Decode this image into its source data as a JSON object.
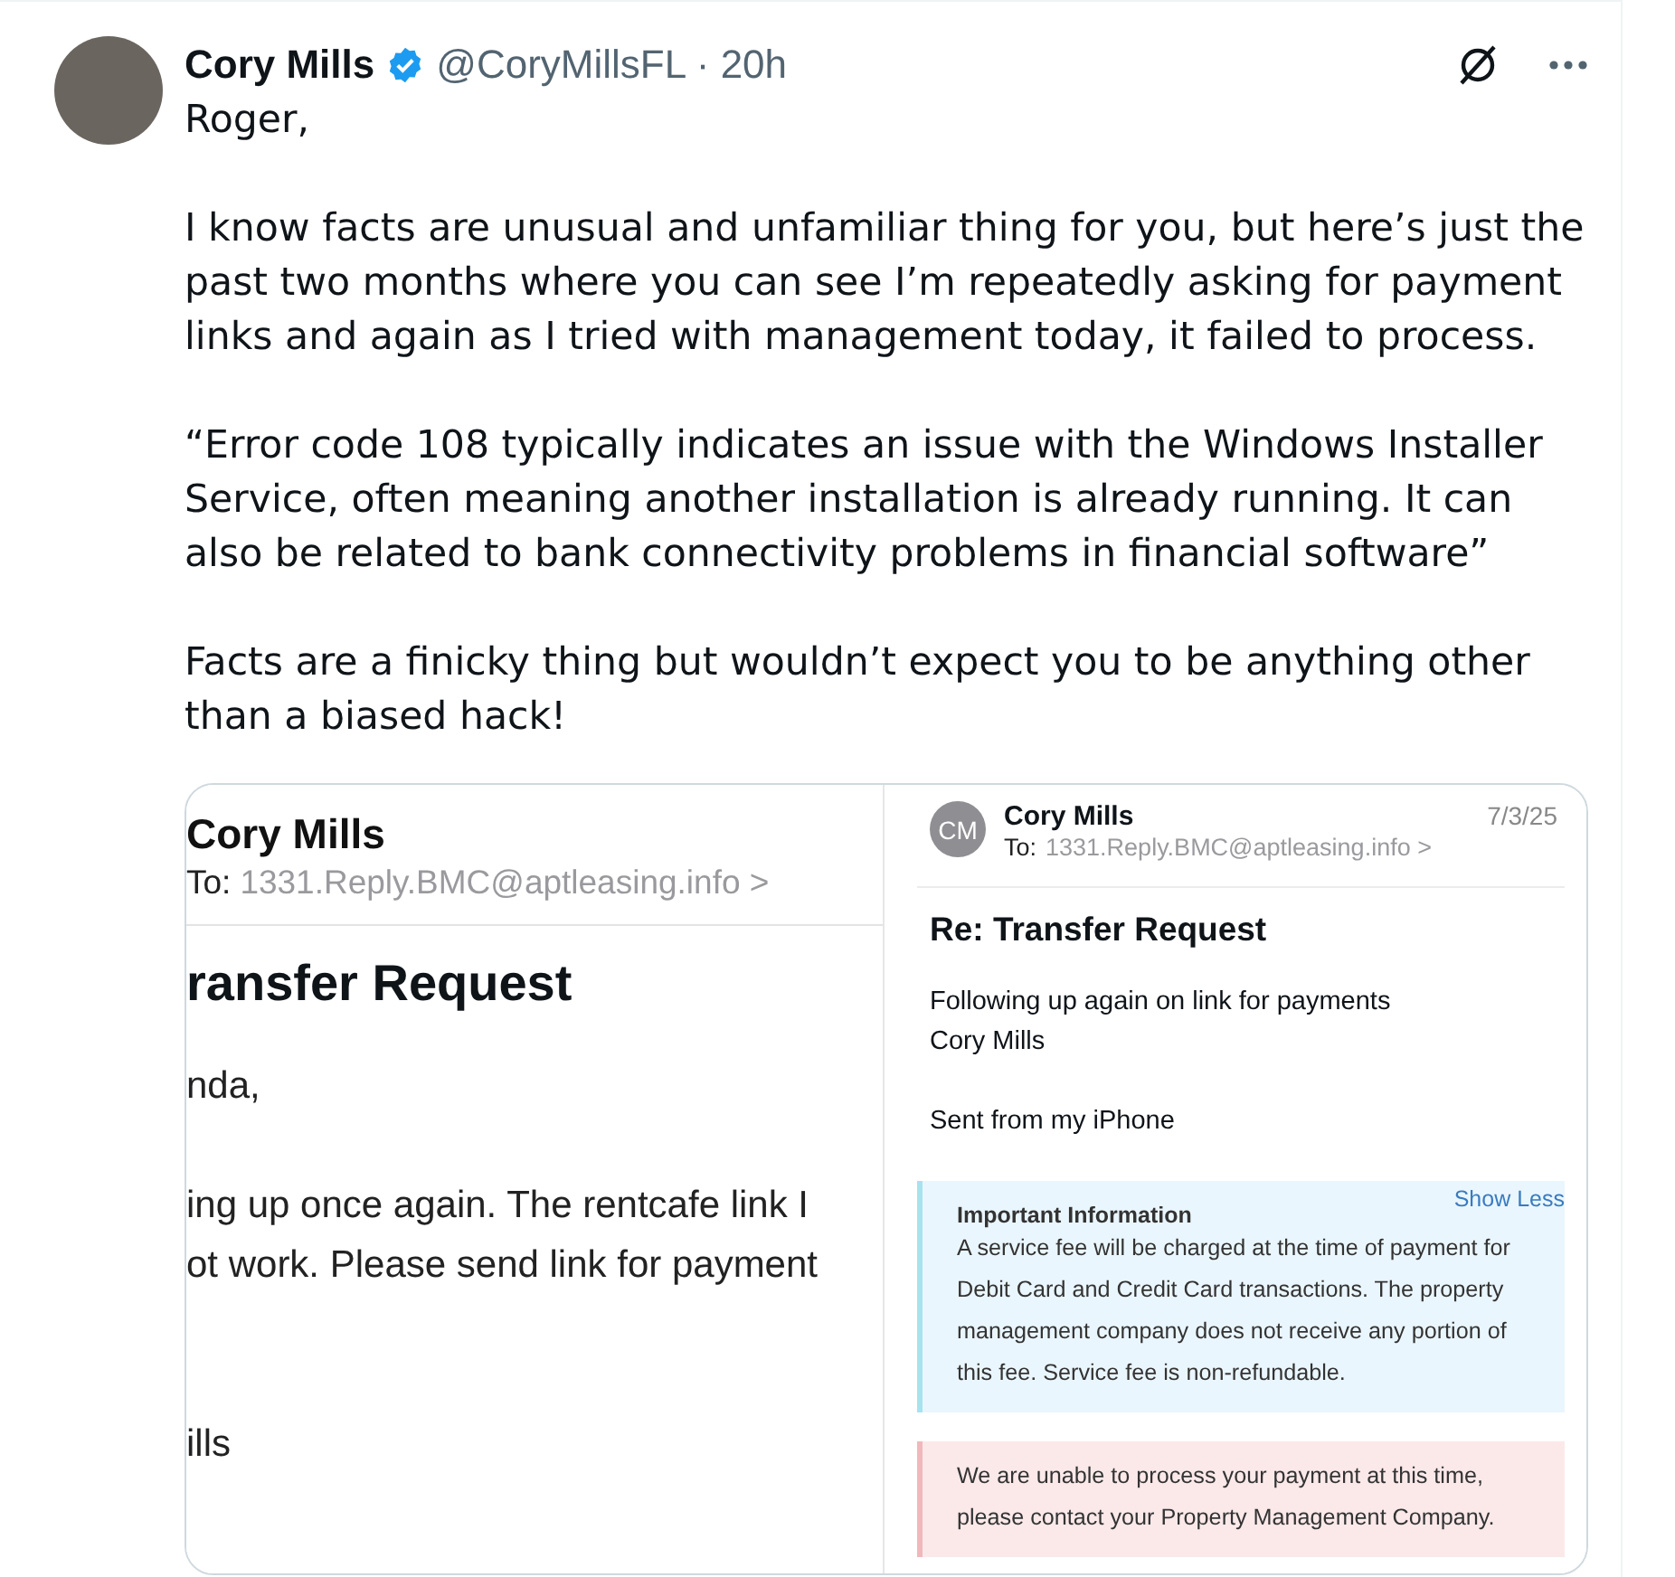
{
  "post": {
    "author": {
      "name": "Cory Mills",
      "verified": true,
      "meta": "@CoryMillsFL · 20h"
    },
    "paragraphs": [
      "Roger,",
      "I know facts are unusual and unfamiliar thing for you, but here’s just the past two months where you can see I’m repeatedly asking for payment links and again as I tried with management today, it failed to process.",
      "“Error code 108 typically indicates an issue with the Windows Installer Service, often meaning another installation is already running. It can also be related to bank connectivity problems in financial software”",
      "Facts are a finicky thing but wouldn’t expect you to be anything other than a biased hack!"
    ]
  },
  "media": {
    "left": {
      "sender": "Cory Mills",
      "to_label": "To:",
      "to_address": "1331.Reply.BMC@aptleasing.info >",
      "subject": "ransfer Request",
      "greeting": "nda,",
      "body_lines": [
        "ing up once again. The rentcafe link I",
        "ot work. Please send link for payment"
      ],
      "signature": "ills"
    },
    "right": {
      "initials": "CM",
      "sender": "Cory Mills",
      "to_label": "To:",
      "to_address": "1331.Reply.BMC@aptleasing.info >",
      "date": "7/3/25",
      "subject": "Re: Transfer Request",
      "body_lines": [
        "Following up again on link for payments",
        "Cory Mills"
      ],
      "footer": "Sent from my iPhone",
      "notices": [
        {
          "kind": "info",
          "title": "Important Information",
          "action": "Show Less",
          "text": "A service fee will be charged at the time of payment for Debit Card and Credit Card transactions. The property management company does not receive any portion of this fee. Service fee is non-refundable."
        },
        {
          "kind": "error",
          "text": "We are unable to process your payment at this time, please contact your Property Management Company."
        }
      ]
    }
  }
}
